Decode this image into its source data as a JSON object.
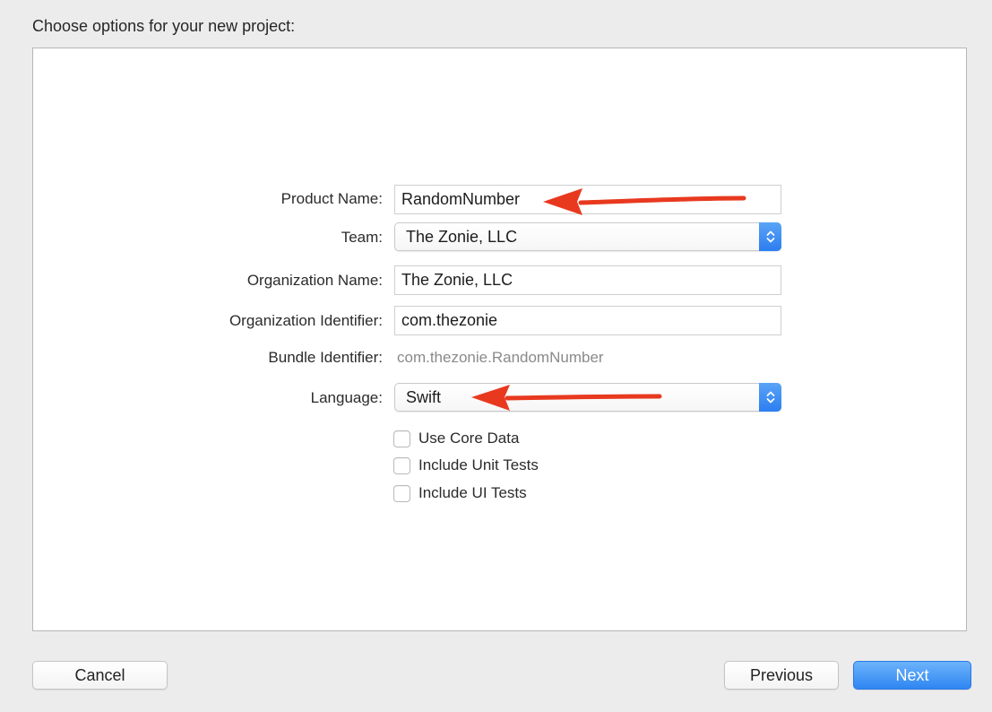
{
  "dialog": {
    "header": "Choose options for your new project:"
  },
  "form": {
    "product_name": {
      "label": "Product Name:",
      "value": "RandomNumber"
    },
    "team": {
      "label": "Team:",
      "value": "The Zonie, LLC"
    },
    "organization_name": {
      "label": "Organization Name:",
      "value": "The Zonie, LLC"
    },
    "organization_identifier": {
      "label": "Organization Identifier:",
      "value": "com.thezonie"
    },
    "bundle_identifier": {
      "label": "Bundle Identifier:",
      "value": "com.thezonie.RandomNumber"
    },
    "language": {
      "label": "Language:",
      "value": "Swift"
    },
    "checkboxes": [
      {
        "label": "Use Core Data",
        "checked": false
      },
      {
        "label": "Include Unit Tests",
        "checked": false
      },
      {
        "label": "Include UI Tests",
        "checked": false
      }
    ]
  },
  "buttons": {
    "cancel": "Cancel",
    "previous": "Previous",
    "next": "Next"
  },
  "colors": {
    "accent_blue": "#2f86f2",
    "annotation_arrow": "#e8391f"
  },
  "icons": {
    "stepper": "up-down-chevron-icon",
    "annotation": "red-arrow-icon"
  }
}
